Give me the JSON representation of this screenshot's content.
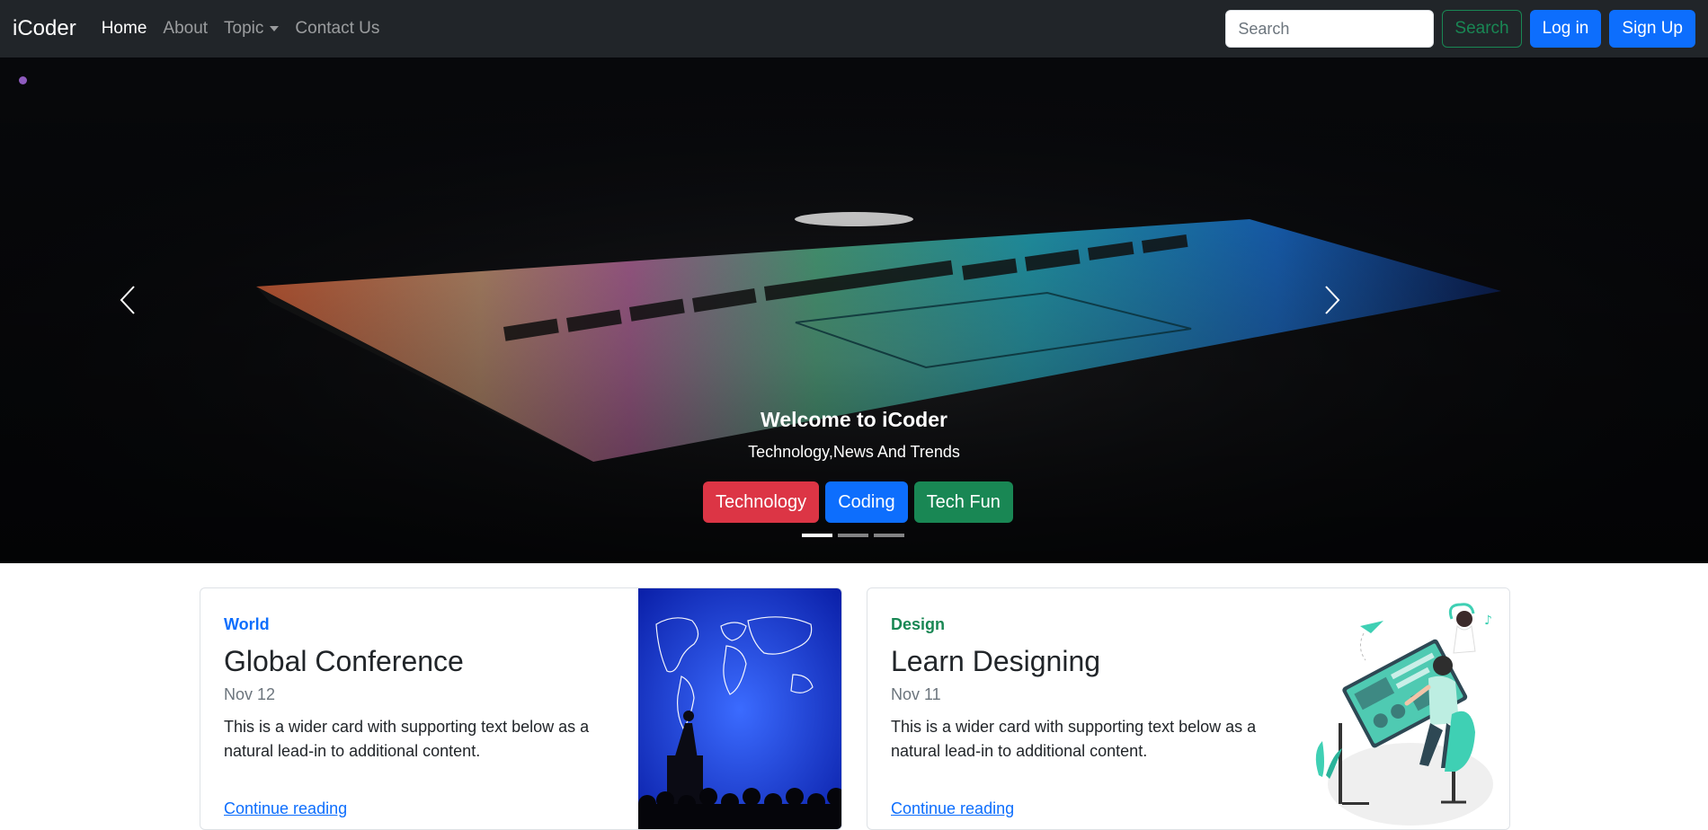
{
  "navbar": {
    "brand": "iCoder",
    "links": {
      "home": "Home",
      "about": "About",
      "topic": "Topic",
      "contact": "Contact Us"
    },
    "search_placeholder": "Search",
    "search_button": "Search",
    "login": "Log in",
    "signup": "Sign Up"
  },
  "hero": {
    "title": "Welcome to iCoder",
    "subtitle": "Technology,News And Trends",
    "buttons": {
      "technology": "Technology",
      "coding": "Coding",
      "techfun": "Tech Fun"
    },
    "slide_count": 3,
    "active_slide": 1
  },
  "cards": [
    {
      "category": "World",
      "title": "Global Conference",
      "date": "Nov 12",
      "text": "This is a wider card with supporting text below as a natural lead-in to additional content.",
      "link": "Continue reading",
      "image": "world-map-conference-image"
    },
    {
      "category": "Design",
      "title": "Learn Designing",
      "date": "Nov 11",
      "text": "This is a wider card with supporting text below as a natural lead-in to additional content.",
      "link": "Continue reading",
      "image": "interactive-design-illustration"
    }
  ],
  "colors": {
    "navbar_bg": "#212529",
    "primary": "#0d6efd",
    "success": "#198754",
    "danger": "#dc3545"
  }
}
